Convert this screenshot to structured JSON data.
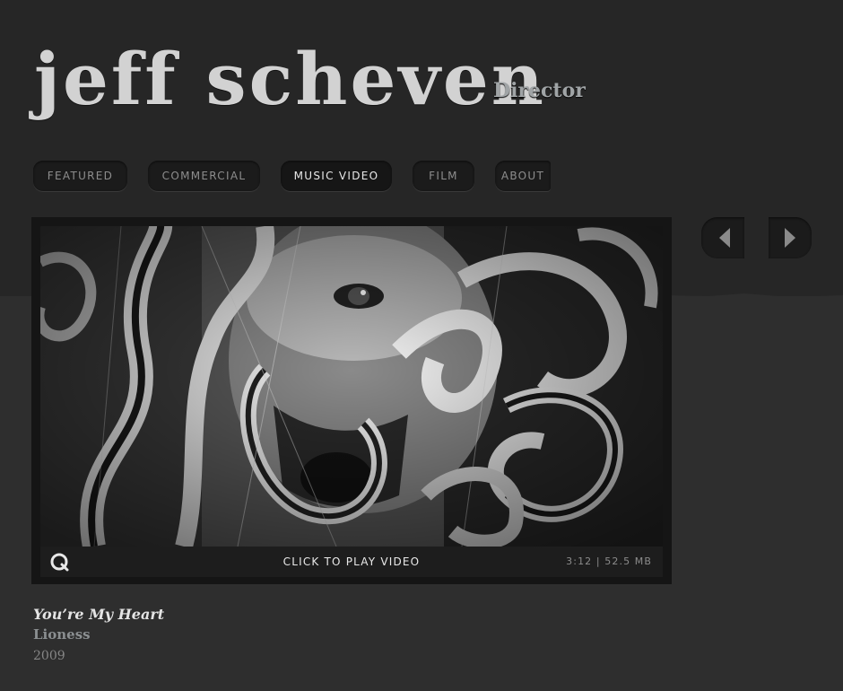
{
  "header": {
    "title": "jeff scheven",
    "subtitle": "Director"
  },
  "nav": {
    "tabs": [
      {
        "label": "FEATURED",
        "active": false
      },
      {
        "label": "COMMERCIAL",
        "active": false
      },
      {
        "label": "MUSIC VIDEO",
        "active": true
      },
      {
        "label": "FILM",
        "active": false
      },
      {
        "label": "ABOUT",
        "active": false
      }
    ]
  },
  "pager": {
    "prev_icon": "chevron-left-icon",
    "next_icon": "chevron-right-icon"
  },
  "video": {
    "player_icon": "quicktime-icon",
    "play_label": "CLICK TO PLAY VIDEO",
    "meta": "3:12 | 52.5 MB",
    "title": "You’re My Heart",
    "artist": "Lioness",
    "year": "2009"
  },
  "colors": {
    "background": "#262626",
    "panel": "#1b1b1b",
    "text_light": "#e8e8e8",
    "text_muted": "#8d8d8d"
  }
}
